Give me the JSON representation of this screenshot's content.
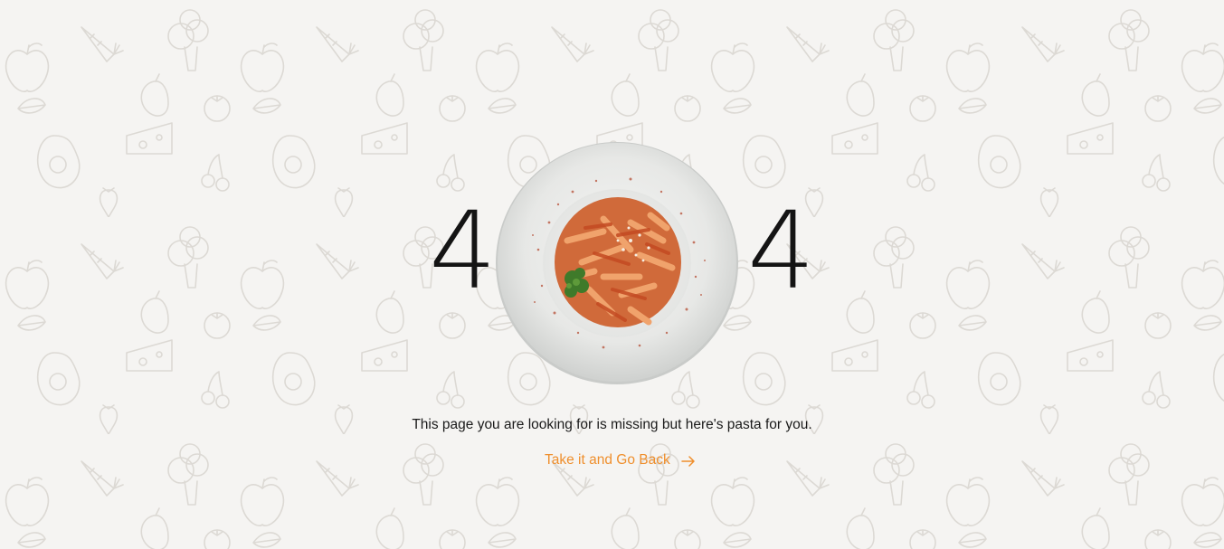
{
  "page": {
    "digit_left": "4",
    "digit_right": "4",
    "message": "This page you are looking for is missing but here's pasta for you.",
    "back_link_label": "Take it and Go Back",
    "back_link_icon": "arrow-right-icon",
    "plate_image": "pasta-plate-image"
  },
  "colors": {
    "background": "#f5f4f2",
    "text": "#1a1a1a",
    "digit": "#141414",
    "accent": "#ef8f2d",
    "pattern": "#dcd9d4"
  }
}
